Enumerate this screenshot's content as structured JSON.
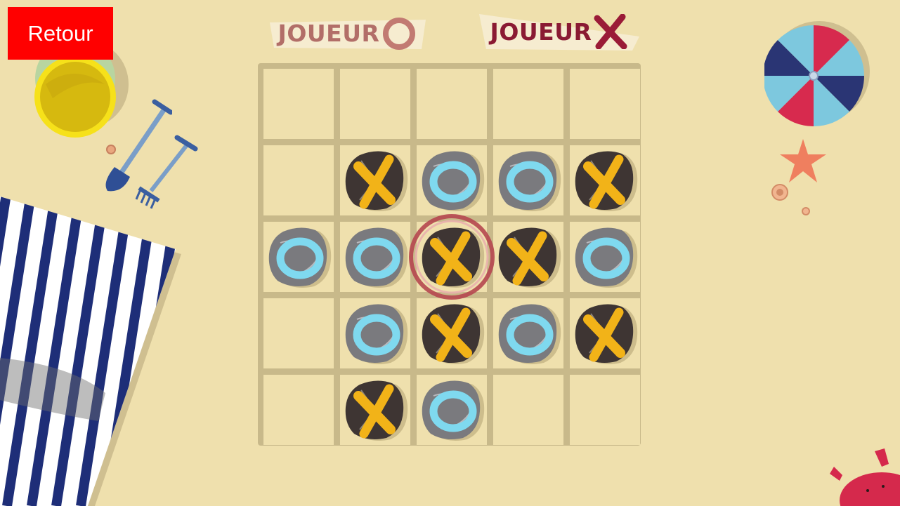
{
  "back_button": {
    "label": "Retour"
  },
  "players": {
    "o": {
      "label": "JOUEUR",
      "symbol": "O"
    },
    "x": {
      "label": "JOUEUR",
      "symbol": "X"
    }
  },
  "board": {
    "rows": 5,
    "cols": 5,
    "cells": [
      [
        "",
        "",
        "",
        "",
        ""
      ],
      [
        "",
        "X",
        "O",
        "O",
        "X"
      ],
      [
        "O",
        "O",
        "X",
        "X",
        "O"
      ],
      [
        "",
        "O",
        "X",
        "O",
        "X"
      ],
      [
        "",
        "X",
        "O",
        "",
        ""
      ]
    ],
    "last_move": {
      "row": 2,
      "col": 2
    }
  },
  "colors": {
    "sand": "#efe0ad",
    "grid": "#c8b98a",
    "stone": "#3e3533",
    "x_mark": "#f2b318",
    "o_mark": "#7fd9ef",
    "highlight": "#b5474f",
    "back_button": "#ff0000"
  },
  "decorations": [
    "bucket-icon",
    "shovel-icon",
    "rake-icon",
    "towel-icon",
    "beach-umbrella-icon",
    "starfish-icon",
    "seashell-icon",
    "crab-icon"
  ]
}
